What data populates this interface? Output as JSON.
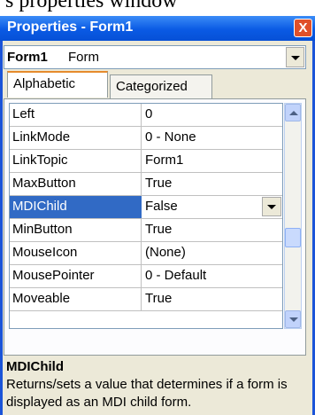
{
  "caption": "s properties window",
  "titlebar": {
    "title": "Properties - Form1",
    "close_label": "X"
  },
  "object_selector": {
    "name": "Form1",
    "type": "Form"
  },
  "tabs": [
    {
      "label": "Alphabetic",
      "active": true
    },
    {
      "label": "Categorized",
      "active": false
    }
  ],
  "properties": [
    {
      "name": "Left",
      "value": "0"
    },
    {
      "name": "LinkMode",
      "value": "0 - None"
    },
    {
      "name": "LinkTopic",
      "value": "Form1"
    },
    {
      "name": "MaxButton",
      "value": "True"
    },
    {
      "name": "MDIChild",
      "value": "False",
      "selected": true
    },
    {
      "name": "MinButton",
      "value": "True"
    },
    {
      "name": "MouseIcon",
      "value": "(None)"
    },
    {
      "name": "MousePointer",
      "value": "0 - Default"
    },
    {
      "name": "Moveable",
      "value": "True"
    }
  ],
  "description": {
    "title": "MDIChild",
    "text": "Returns/sets a value that determines if a form is displayed as an MDI child form."
  },
  "colors": {
    "title_bar": "#0a5ae4",
    "selection": "#316ac5",
    "close_button": "#e0502a"
  }
}
